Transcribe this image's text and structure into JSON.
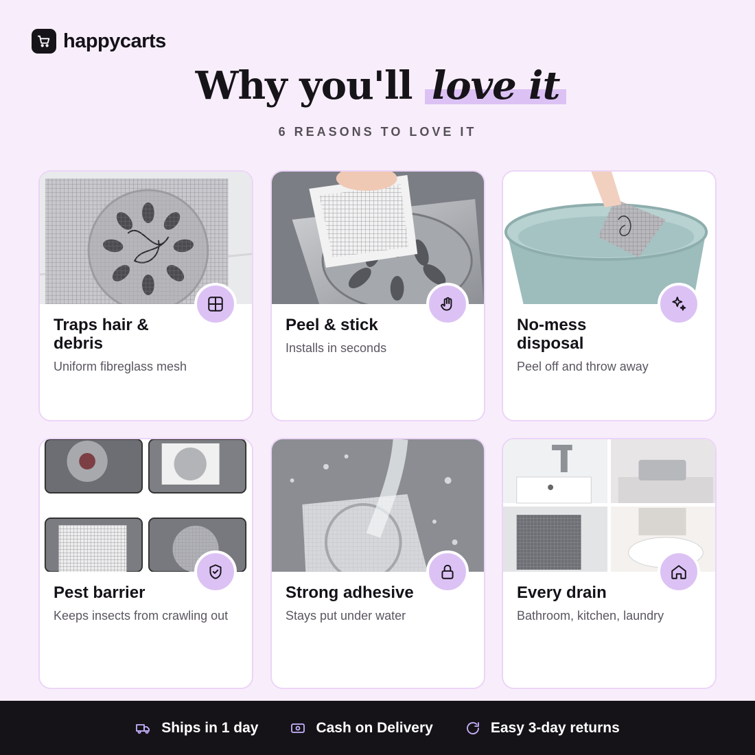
{
  "brand": {
    "name": "happycarts",
    "icon": "cart-icon"
  },
  "heading": {
    "main": "Why you'll",
    "accent": "love it"
  },
  "subheading": "6 REASONS TO LOVE IT",
  "cards": [
    {
      "title": "Traps hair & debris",
      "description": "Uniform fibreglass mesh",
      "icon": "grid-icon"
    },
    {
      "title": "Peel & stick",
      "description": "Installs in seconds",
      "icon": "hand-icon"
    },
    {
      "title": "No-mess disposal",
      "description": "Peel off and throw away",
      "icon": "sparkle-icon"
    },
    {
      "title": "Pest barrier",
      "description": "Keeps insects from crawling out",
      "icon": "shield-check-icon"
    },
    {
      "title": "Strong adhesive",
      "description": "Stays put under water",
      "icon": "lock-icon"
    },
    {
      "title": "Every drain",
      "description": "Bathroom, kitchen, laundry",
      "icon": "home-icon"
    }
  ],
  "footer": [
    {
      "label": "Ships in 1 day",
      "icon": "truck-icon"
    },
    {
      "label": "Cash on Delivery",
      "icon": "cash-icon"
    },
    {
      "label": "Easy 3-day returns",
      "icon": "returns-icon"
    }
  ],
  "colors": {
    "background": "#f8eefb",
    "accent": "#dcc2f4",
    "card_border": "#ecd4f7",
    "footer": "#151318"
  }
}
